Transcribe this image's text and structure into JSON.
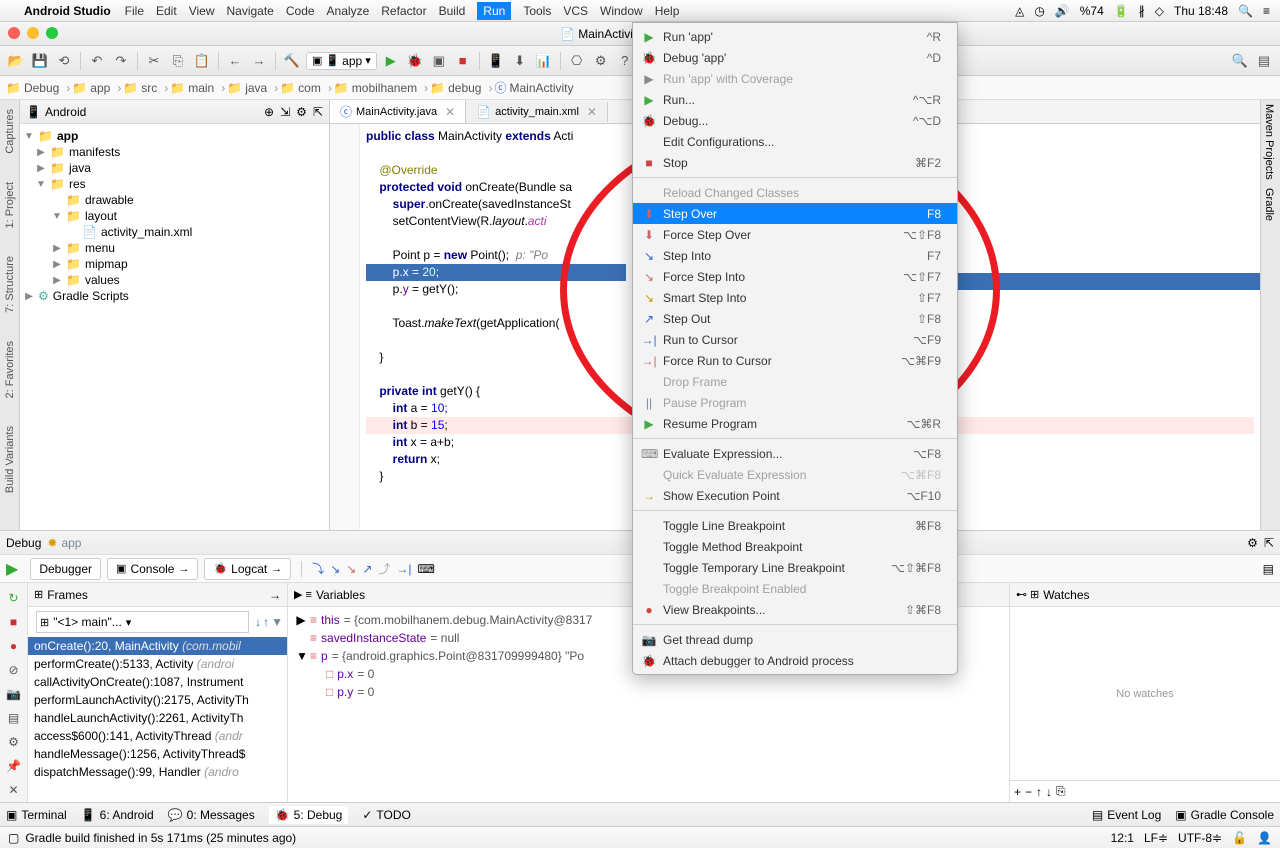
{
  "menubar": {
    "app": "Android Studio",
    "items": [
      "File",
      "Edit",
      "View",
      "Navigate",
      "Code",
      "Analyze",
      "Refactor",
      "Build",
      "Run",
      "Tools",
      "VCS",
      "Window",
      "Help"
    ],
    "active_index": 8,
    "battery": "%74",
    "clock": "Thu 18:48"
  },
  "window": {
    "title": "MainActivity.java - Debug -"
  },
  "breadcrumbs": [
    "Debug",
    "app",
    "src",
    "main",
    "java",
    "com",
    "mobilhanem",
    "debug",
    "MainActivity"
  ],
  "toolbar": {
    "run_config": "app"
  },
  "project": {
    "title": "Android",
    "tree": [
      {
        "d": 0,
        "arrow": "▼",
        "icon": "📁",
        "label": "app",
        "bold": true
      },
      {
        "d": 1,
        "arrow": "▶",
        "icon": "📁",
        "label": "manifests"
      },
      {
        "d": 1,
        "arrow": "▶",
        "icon": "📁",
        "label": "java"
      },
      {
        "d": 1,
        "arrow": "▼",
        "icon": "📁",
        "label": "res"
      },
      {
        "d": 2,
        "arrow": "",
        "icon": "📁",
        "label": "drawable"
      },
      {
        "d": 2,
        "arrow": "▼",
        "icon": "📁",
        "label": "layout"
      },
      {
        "d": 3,
        "arrow": "",
        "icon": "📄",
        "label": "activity_main.xml"
      },
      {
        "d": 2,
        "arrow": "▶",
        "icon": "📁",
        "label": "menu"
      },
      {
        "d": 2,
        "arrow": "▶",
        "icon": "📁",
        "label": "mipmap"
      },
      {
        "d": 2,
        "arrow": "▶",
        "icon": "📁",
        "label": "values"
      },
      {
        "d": 0,
        "arrow": "▶",
        "icon": "⚙",
        "label": "Gradle Scripts",
        "color": "#4a9"
      }
    ]
  },
  "editor": {
    "tabs": [
      {
        "icon": "ⓒ",
        "label": "MainActivity.java",
        "active": true
      },
      {
        "icon": "📄",
        "label": "activity_main.xml",
        "active": false
      }
    ]
  },
  "left_tabs": [
    "Captures",
    "1: Project",
    "7: Structure",
    "2: Favorites",
    "Build Variants"
  ],
  "right_tabs": [
    "Maven Projects",
    "Gradle"
  ],
  "debug": {
    "title": "Debug",
    "process": "app",
    "tabs": [
      "Debugger",
      "Console",
      "Logcat"
    ],
    "frames_title": "Frames",
    "vars_title": "Variables",
    "watches_title": "Watches",
    "thread": "\"<1> main\"...",
    "frames": [
      {
        "label": "onCreate():20, MainActivity",
        "pkg": "(com.mobil",
        "sel": true
      },
      {
        "label": "performCreate():5133, Activity",
        "pkg": "(androi"
      },
      {
        "label": "callActivityOnCreate():1087, Instrument",
        "pkg": ""
      },
      {
        "label": "performLaunchActivity():2175, ActivityTh",
        "pkg": ""
      },
      {
        "label": "handleLaunchActivity():2261, ActivityTh",
        "pkg": ""
      },
      {
        "label": "access$600():141, ActivityThread",
        "pkg": "(andr"
      },
      {
        "label": "handleMessage():1256, ActivityThread$",
        "pkg": ""
      },
      {
        "label": "dispatchMessage():99, Handler",
        "pkg": "(andro"
      }
    ],
    "variables": [
      {
        "d": 0,
        "arrow": "▶",
        "icon": "≡",
        "name": "this",
        "val": " = {com.mobilhanem.debug.MainActivity@8317"
      },
      {
        "d": 0,
        "arrow": "",
        "icon": "≡",
        "name": "savedInstanceState",
        "val": " = null"
      },
      {
        "d": 0,
        "arrow": "▼",
        "icon": "≡",
        "name": "p",
        "val": " = {android.graphics.Point@831709999480} \"Po"
      },
      {
        "d": 1,
        "arrow": "",
        "icon": "□",
        "name": "p.x",
        "val": " = 0"
      },
      {
        "d": 1,
        "arrow": "",
        "icon": "□",
        "name": "p.y",
        "val": " = 0"
      }
    ],
    "no_watches": "No watches"
  },
  "bottom_tabs": {
    "left": [
      "Terminal",
      "6: Android",
      "0: Messages",
      "5: Debug",
      "TODO"
    ],
    "right": [
      "Event Log",
      "Gradle Console"
    ]
  },
  "status": {
    "message": "Gradle build finished in 5s 171ms (25 minutes ago)",
    "pos": "12:1",
    "le": "LF≑",
    "enc": "UTF-8≑"
  },
  "run_menu": [
    {
      "icon": "▶",
      "color": "#4a4",
      "label": "Run 'app'",
      "shortcut": "^R"
    },
    {
      "icon": "🐞",
      "color": "#4a4",
      "label": "Debug 'app'",
      "shortcut": "^D"
    },
    {
      "icon": "▶",
      "label": "Run 'app' with Coverage",
      "disabled": true
    },
    {
      "icon": "▶",
      "color": "#4a4",
      "label": "Run...",
      "shortcut": "^⌥R"
    },
    {
      "icon": "🐞",
      "color": "#4a4",
      "label": "Debug...",
      "shortcut": "^⌥D"
    },
    {
      "icon": "",
      "label": "Edit Configurations..."
    },
    {
      "icon": "■",
      "color": "#c44",
      "label": "Stop",
      "shortcut": "⌘F2"
    },
    {
      "sep": true
    },
    {
      "icon": "",
      "label": "Reload Changed Classes",
      "disabled": true
    },
    {
      "icon": "⬇",
      "color": "#c66",
      "label": "Step Over",
      "shortcut": "F8",
      "highlighted": true
    },
    {
      "icon": "⬇",
      "color": "#c66",
      "label": "Force Step Over",
      "shortcut": "⌥⇧F8"
    },
    {
      "icon": "↘",
      "color": "#36c",
      "label": "Step Into",
      "shortcut": "F7"
    },
    {
      "icon": "↘",
      "color": "#c66",
      "label": "Force Step Into",
      "shortcut": "⌥⇧F7"
    },
    {
      "icon": "↘",
      "color": "#c90",
      "label": "Smart Step Into",
      "shortcut": "⇧F7"
    },
    {
      "icon": "↗",
      "color": "#36c",
      "label": "Step Out",
      "shortcut": "⇧F8"
    },
    {
      "icon": "→|",
      "color": "#36c",
      "label": "Run to Cursor",
      "shortcut": "⌥F9"
    },
    {
      "icon": "→|",
      "color": "#c66",
      "label": "Force Run to Cursor",
      "shortcut": "⌥⌘F9"
    },
    {
      "icon": "",
      "label": "Drop Frame",
      "disabled": true
    },
    {
      "icon": "||",
      "color": "#789",
      "label": "Pause Program",
      "disabled": true
    },
    {
      "icon": "▶",
      "color": "#4a4",
      "label": "Resume Program",
      "shortcut": "⌥⌘R"
    },
    {
      "sep": true
    },
    {
      "icon": "⌨",
      "label": "Evaluate Expression...",
      "shortcut": "⌥F8"
    },
    {
      "icon": "",
      "label": "Quick Evaluate Expression",
      "shortcut": "⌥⌘F8",
      "disabled": true
    },
    {
      "icon": "→",
      "color": "#c90",
      "label": "Show Execution Point",
      "shortcut": "⌥F10"
    },
    {
      "sep": true
    },
    {
      "icon": "",
      "label": "Toggle Line Breakpoint",
      "shortcut": "⌘F8"
    },
    {
      "icon": "",
      "label": "Toggle Method Breakpoint"
    },
    {
      "icon": "",
      "label": "Toggle Temporary Line Breakpoint",
      "shortcut": "⌥⇧⌘F8"
    },
    {
      "icon": "",
      "label": "Toggle Breakpoint Enabled",
      "disabled": true
    },
    {
      "icon": "●",
      "color": "#c44",
      "label": "View Breakpoints...",
      "shortcut": "⇧⌘F8"
    },
    {
      "sep": true
    },
    {
      "icon": "📷",
      "label": "Get thread dump"
    },
    {
      "icon": "🐞",
      "label": "Attach debugger to Android process"
    }
  ]
}
